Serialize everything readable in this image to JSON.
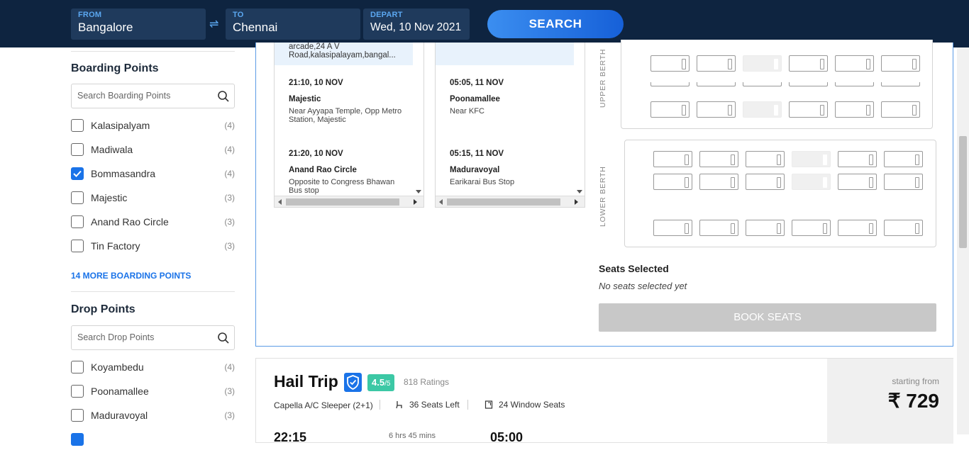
{
  "search": {
    "from_label": "FROM",
    "from_value": "Bangalore",
    "swap_icon": "⇌",
    "to_label": "TO",
    "to_value": "Chennai",
    "depart_label": "DEPART",
    "depart_value": "Wed, 10 Nov 2021",
    "search_button": "SEARCH"
  },
  "sidebar": {
    "boarding_title": "Boarding Points",
    "boarding_search_placeholder": "Search Boarding Points",
    "boarding_points": [
      {
        "label": "Kalasipalyam",
        "count": "(4)",
        "checked": false
      },
      {
        "label": "Madiwala",
        "count": "(4)",
        "checked": false
      },
      {
        "label": "Bommasandra",
        "count": "(4)",
        "checked": true
      },
      {
        "label": "Majestic",
        "count": "(3)",
        "checked": false
      },
      {
        "label": "Anand Rao Circle",
        "count": "(3)",
        "checked": false
      },
      {
        "label": "Tin Factory",
        "count": "(3)",
        "checked": false
      }
    ],
    "more_boarding": "14 MORE BOARDING POINTS",
    "drop_title": "Drop Points",
    "drop_search_placeholder": "Search Drop Points",
    "drop_points": [
      {
        "label": "Koyambedu",
        "count": "(4)",
        "checked": false
      },
      {
        "label": "Poonamallee",
        "count": "(3)",
        "checked": false
      },
      {
        "label": "Maduravoyal",
        "count": "(3)",
        "checked": false
      }
    ]
  },
  "boarding_list": {
    "top_text": "arcade,24 A V Road,kalasipalayam,bangal...",
    "points": [
      {
        "time": "21:10, 10 NOV",
        "name": "Majestic",
        "address": "Near Ayyapa Temple, Opp Metro Station, Majestic"
      },
      {
        "time": "21:20, 10 NOV",
        "name": "Anand Rao Circle",
        "address": "Opposite to Congress Bhawan Bus stop"
      }
    ]
  },
  "drop_list": {
    "top_text": "",
    "points": [
      {
        "time": "05:05, 11 NOV",
        "name": "Poonamallee",
        "address": "Near KFC"
      },
      {
        "time": "05:15, 11 NOV",
        "name": "Maduravoyal",
        "address": "Earikarai Bus Stop"
      }
    ]
  },
  "seat_map": {
    "upper_label": "UPPER BERTH",
    "lower_label": "LOWER BERTH",
    "selected_title": "Seats Selected",
    "selected_text": "No seats selected yet",
    "book_button": "BOOK SEATS"
  },
  "operator": {
    "name": "Hail Trip",
    "verified_icon": "shield-check-icon",
    "rating": "4.5",
    "rating_scale": "/5",
    "ratings_count": "818 Ratings",
    "bus_type": "Capella A/C Sleeper (2+1)",
    "seats_left": "36 Seats Left",
    "window_seats": "24 Window Seats",
    "starting_from": "starting from",
    "price": "₹ 729",
    "peek_departure": "22:15",
    "peek_duration": "6 hrs 45 mins",
    "peek_arrival": "05:00"
  },
  "colors": {
    "header_bg": "#0e2440",
    "accent": "#1a73e8",
    "rating_badge": "#3cc8a5"
  }
}
